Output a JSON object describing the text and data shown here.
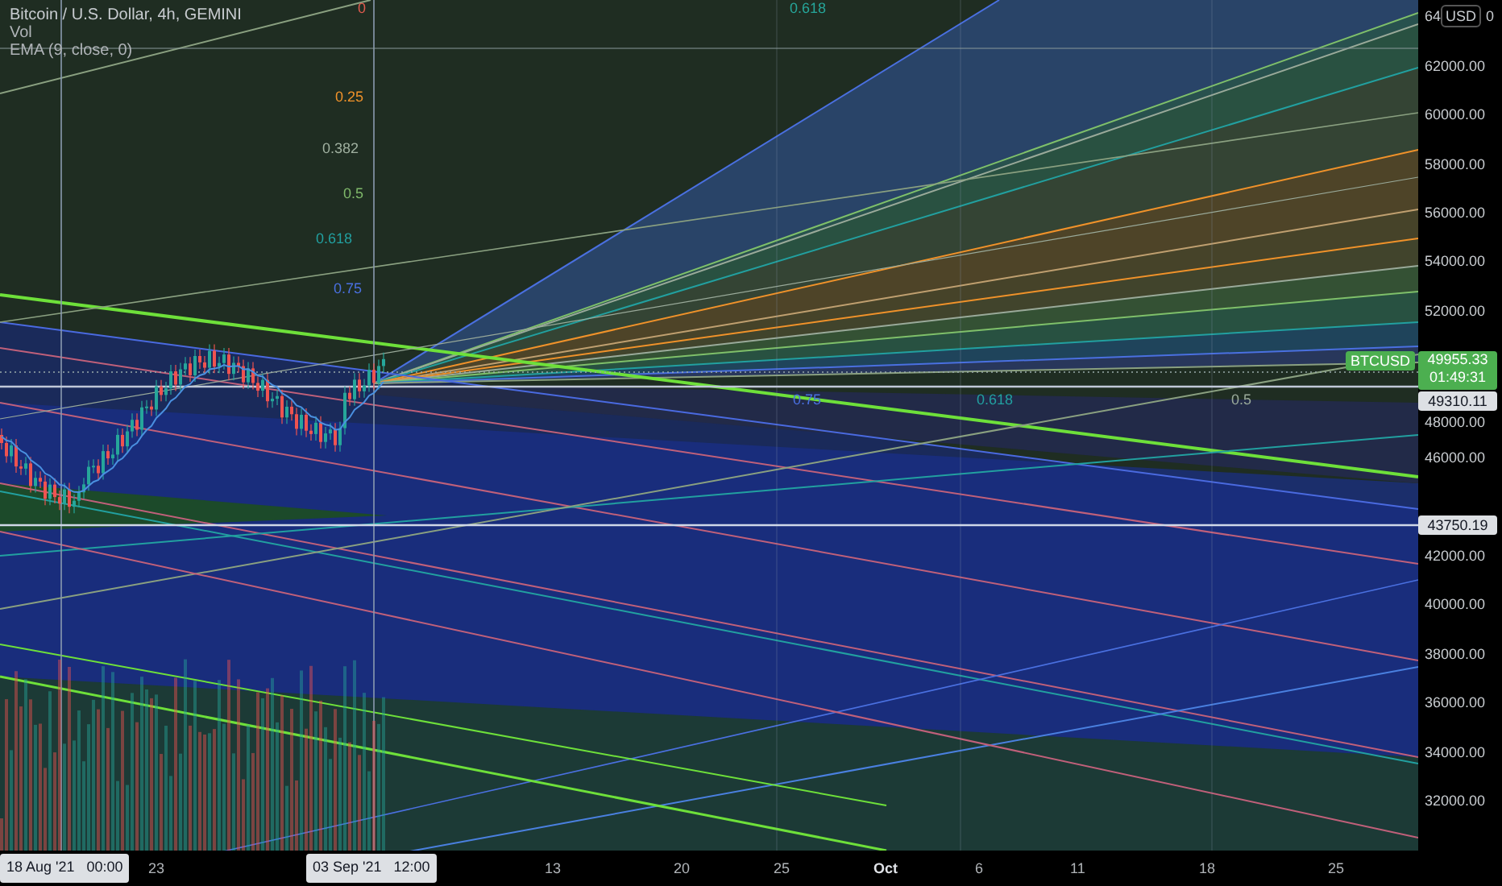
{
  "legend": {
    "symbol": "Bitcoin / U.S. Dollar, 4h, GEMINI",
    "indicators": [
      "Vol",
      "EMA (9, close, 0)"
    ]
  },
  "fib_labels": [
    {
      "text": "0",
      "color": "#e05a4e"
    },
    {
      "text": "0.618",
      "color": "#26a69a"
    },
    {
      "text": "0.25",
      "color": "#f0922a"
    },
    {
      "text": "0.382",
      "color": "#a0b0a0"
    },
    {
      "text": "0.5",
      "color": "#7fb86a"
    },
    {
      "text": "0.618",
      "color": "#22a0a0"
    },
    {
      "text": "0.75",
      "color": "#4a70e0"
    },
    {
      "text": "0.75",
      "color": "#4a70e0"
    },
    {
      "text": "0.618",
      "color": "#22a0a0"
    },
    {
      "text": "0.5",
      "color": "#9aaa9a"
    }
  ],
  "price_axis": {
    "currency": "USD",
    "top_tick_parts": [
      "64",
      "0"
    ],
    "ticks": [
      "62000.00",
      "60000.00",
      "58000.00",
      "56000.00",
      "54000.00",
      "52000.00",
      "48000.00",
      "46000.00",
      "42000.00",
      "40000.00",
      "38000.00",
      "36000.00",
      "34000.00",
      "32000.00"
    ],
    "symbol_tag": "BTCUSD",
    "last_price": "49955.33",
    "countdown": "01:49:31",
    "crosshair_price": "49310.11",
    "line_price": "43750.19"
  },
  "time_axis": [
    {
      "text": "18 Aug '21   00:00",
      "kind": "crosshair"
    },
    {
      "text": "23",
      "kind": "day"
    },
    {
      "text": "03 Sep '21   12:00",
      "kind": "crosshair"
    },
    {
      "text": "13",
      "kind": "day"
    },
    {
      "text": "20",
      "kind": "day"
    },
    {
      "text": "25",
      "kind": "day"
    },
    {
      "text": "Oct",
      "kind": "month"
    },
    {
      "text": "6",
      "kind": "day"
    },
    {
      "text": "11",
      "kind": "day"
    },
    {
      "text": "18",
      "kind": "day"
    },
    {
      "text": "25",
      "kind": "day"
    }
  ]
}
